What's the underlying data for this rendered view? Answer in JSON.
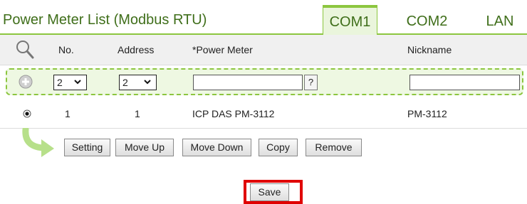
{
  "header": {
    "title": "Power Meter List (Modbus RTU)",
    "tabs": [
      "COM1",
      "COM2",
      "LAN"
    ],
    "active_tab": "COM1"
  },
  "table": {
    "columns": {
      "no": "No.",
      "address": "Address",
      "power_meter": "*Power Meter",
      "nickname": "Nickname"
    },
    "add_row": {
      "no_value": "2",
      "address_value": "2",
      "power_meter_value": "",
      "help_label": "?",
      "nickname_value": ""
    },
    "rows": [
      {
        "selected": true,
        "no": "1",
        "address": "1",
        "power_meter": "ICP DAS PM-3112",
        "nickname": "PM-3112"
      }
    ]
  },
  "actions": {
    "setting": "Setting",
    "move_up": "Move Up",
    "move_down": "Move Down",
    "copy": "Copy",
    "remove": "Remove"
  },
  "save_label": "Save",
  "colors": {
    "accent": "#8cc63f",
    "title": "#3f6e1a",
    "highlight": "#e00000"
  }
}
